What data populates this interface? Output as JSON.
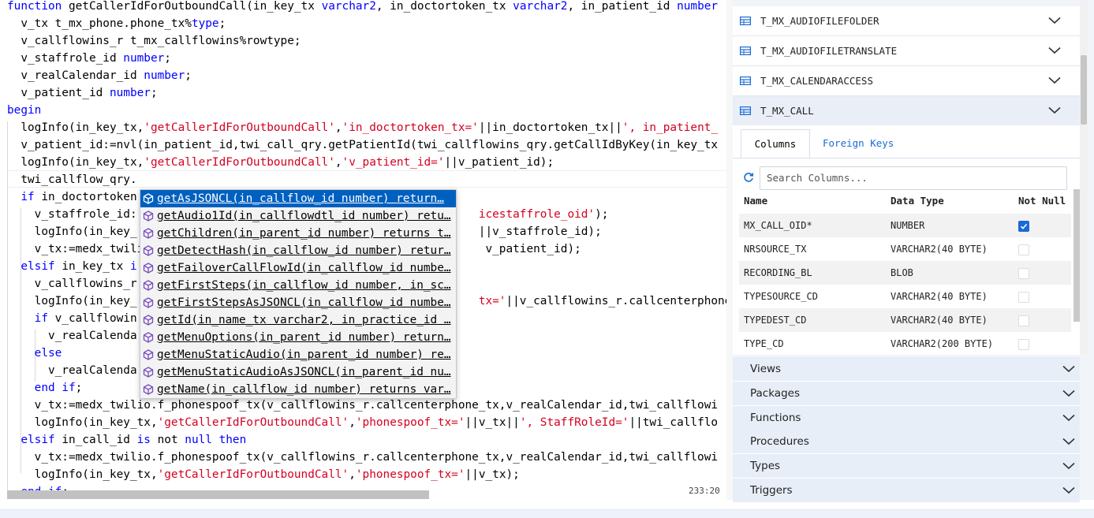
{
  "editor": {
    "lines": [
      [
        [
          "kw",
          "function "
        ],
        [
          "pl",
          "getCallerIdForOutboundCall(in_key_tx "
        ],
        [
          "kw",
          "varchar2"
        ],
        [
          "pl",
          ", in_doctortoken_tx "
        ],
        [
          "kw",
          "varchar2"
        ],
        [
          "pl",
          ", in_patient_id "
        ],
        [
          "kw",
          "number"
        ]
      ],
      [
        [
          "pl",
          "  v_tx t_mx_phone.phone_tx%"
        ],
        [
          "kw",
          "type"
        ],
        [
          "pl",
          ";"
        ]
      ],
      [
        [
          "pl",
          "  v_callflowins_r t_mx_callflowins%rowtype;"
        ]
      ],
      [
        [
          "pl",
          "  v_staffrole_id "
        ],
        [
          "kw",
          "number"
        ],
        [
          "pl",
          ";"
        ]
      ],
      [
        [
          "pl",
          "  v_realCalendar_id "
        ],
        [
          "kw",
          "number"
        ],
        [
          "pl",
          ";"
        ]
      ],
      [
        [
          "pl",
          "  v_patient_id "
        ],
        [
          "kw",
          "number"
        ],
        [
          "pl",
          ";"
        ]
      ],
      [
        [
          "kw",
          "begin"
        ]
      ],
      [
        [
          "pl",
          "  logInfo(in_key_tx,"
        ],
        [
          "str",
          "'getCallerIdForOutboundCall'"
        ],
        [
          "pl",
          ","
        ],
        [
          "str",
          "'in_doctortoken_tx='"
        ],
        [
          "pl",
          "||in_doctortoken_tx||"
        ],
        [
          "str",
          "', in_patient_"
        ]
      ],
      [
        [
          "pl",
          "  v_patient_id:=nvl(in_patient_id,twi_call_qry.getPatientId(twi_callflowins_qry.getCallIdByKey(in_key_tx"
        ]
      ],
      [
        [
          "pl",
          "  logInfo(in_key_tx,"
        ],
        [
          "str",
          "'getCallerIdForOutboundCall'"
        ],
        [
          "pl",
          ","
        ],
        [
          "str",
          "'v_patient_id='"
        ],
        [
          "pl",
          "||v_patient_id);"
        ]
      ],
      [
        [
          "pl",
          "  twi_callflow_qry."
        ]
      ],
      [
        [
          "pl",
          "  "
        ],
        [
          "kw",
          "if"
        ],
        [
          "pl",
          " in_doctortoken"
        ]
      ],
      [
        [
          "pl",
          "    v_staffrole_id:                                                  "
        ],
        [
          "str",
          "icestaffrole_oid'"
        ],
        [
          "pl",
          ");"
        ]
      ],
      [
        [
          "pl",
          "    logInfo(in_key_                                                  ||v_staffrole_id);"
        ]
      ],
      [
        [
          "pl",
          "    v_tx:=medx_twili                                                  v_patient_id);"
        ]
      ],
      [
        [
          "pl",
          "  "
        ],
        [
          "kw",
          "elsif"
        ],
        [
          "pl",
          " in_key_tx "
        ],
        [
          "kw",
          "i"
        ]
      ],
      [
        [
          "pl",
          "    v_callflowins_r"
        ]
      ],
      [
        [
          "pl",
          "    logInfo(in_key_                                                  "
        ],
        [
          "str",
          "tx='"
        ],
        [
          "pl",
          "||v_callflowins_r.callcenterphone"
        ]
      ],
      [
        [
          "pl",
          "    "
        ],
        [
          "kw",
          "if"
        ],
        [
          "pl",
          " v_callflowin"
        ]
      ],
      [
        [
          "pl",
          "      v_realCalenda"
        ]
      ],
      [
        [
          "pl",
          "    "
        ],
        [
          "kw",
          "else"
        ]
      ],
      [
        [
          "pl",
          "      v_realCalenda"
        ]
      ],
      [
        [
          "pl",
          "    "
        ],
        [
          "kw",
          "end if"
        ],
        [
          "pl",
          ";"
        ]
      ],
      [
        [
          "pl",
          "    v_tx:=medx_twilio.f_phonespoof_tx(v_callflowins_r.callcenterphone_tx,v_realCalendar_id,twi_callflowi"
        ]
      ],
      [
        [
          "pl",
          "    logInfo(in_key_tx,"
        ],
        [
          "str",
          "'getCallerIdForOutboundCall'"
        ],
        [
          "pl",
          ","
        ],
        [
          "str",
          "'phonespoof_tx='"
        ],
        [
          "pl",
          "||v_tx||"
        ],
        [
          "str",
          "', StaffRoleId='"
        ],
        [
          "pl",
          "||twi_callflo"
        ]
      ],
      [
        [
          "pl",
          "  "
        ],
        [
          "kw",
          "elsif"
        ],
        [
          "pl",
          " in_call_id "
        ],
        [
          "kw",
          "is"
        ],
        [
          "pl",
          " not "
        ],
        [
          "kw",
          "null then"
        ]
      ],
      [
        [
          "pl",
          "    v_tx:=medx_twilio.f_phonespoof_tx(v_callflowins_r.callcenterphone_tx,v_realCalendar_id,twi_callflowi"
        ]
      ],
      [
        [
          "pl",
          "    logInfo(in_key_tx,"
        ],
        [
          "str",
          "'getCallerIdForOutboundCall'"
        ],
        [
          "pl",
          ","
        ],
        [
          "str",
          "'phonespoof_tx='"
        ],
        [
          "pl",
          "||v_tx);"
        ]
      ],
      [
        [
          "pl",
          "  "
        ],
        [
          "kw",
          "end if"
        ],
        [
          "pl",
          ";"
        ]
      ]
    ],
    "cursor_position": "233:20"
  },
  "autocomplete": {
    "items": [
      "getAsJSONCL(in_callflow_id number) return…",
      "getAudio1Id(in_callflowdtl_id number) retu…",
      "getChildren(in_parent_id number) returns t…",
      "getDetectHash(in_callflow_id number) retur…",
      "getFailoverCallFlowId(in_callflow_id numbe…",
      "getFirstSteps(in_callflow_id number, in_sc…",
      "getFirstStepsAsJSONCL(in_callflow_id numbe…",
      "getId(in_name_tx varchar2, in_practice_id …",
      "getMenuOptions(in_parent_id number) return…",
      "getMenuStaticAudio(in_parent_id number) re…",
      "getMenuStaticAudioAsJSONCL(in_parent_id nu…",
      "getName(in_callflow_id number) returns var…"
    ],
    "selected_index": 0
  },
  "tables": [
    {
      "name": "T_MX_AUDIOFILEFOLDER"
    },
    {
      "name": "T_MX_AUDIOFILETRANSLATE"
    },
    {
      "name": "T_MX_CALENDARACCESS"
    },
    {
      "name": "T_MX_CALL"
    }
  ],
  "detail": {
    "tabs": [
      "Columns",
      "Foreign Keys"
    ],
    "active_tab": "Columns",
    "search_placeholder": "Search Columns...",
    "headers": [
      "Name",
      "Data Type",
      "Not Null"
    ],
    "columns": [
      {
        "name": "MX_CALL_OID*",
        "type": "NUMBER",
        "not_null": true
      },
      {
        "name": "NRSOURCE_TX",
        "type": "VARCHAR2(40 BYTE)",
        "not_null": false
      },
      {
        "name": "RECORDING_BL",
        "type": "BLOB",
        "not_null": false
      },
      {
        "name": "TYPESOURCE_CD",
        "type": "VARCHAR2(40 BYTE)",
        "not_null": false
      },
      {
        "name": "TYPEDEST_CD",
        "type": "VARCHAR2(40 BYTE)",
        "not_null": false
      },
      {
        "name": "TYPE_CD",
        "type": "VARCHAR2(200 BYTE)",
        "not_null": false
      }
    ]
  },
  "sections": [
    "Views",
    "Packages",
    "Functions",
    "Procedures",
    "Types",
    "Triggers"
  ],
  "colors": {
    "keyword": "#0000ff",
    "string": "#d4001f",
    "accent": "#1a6ad6",
    "selection": "#0060c0"
  }
}
